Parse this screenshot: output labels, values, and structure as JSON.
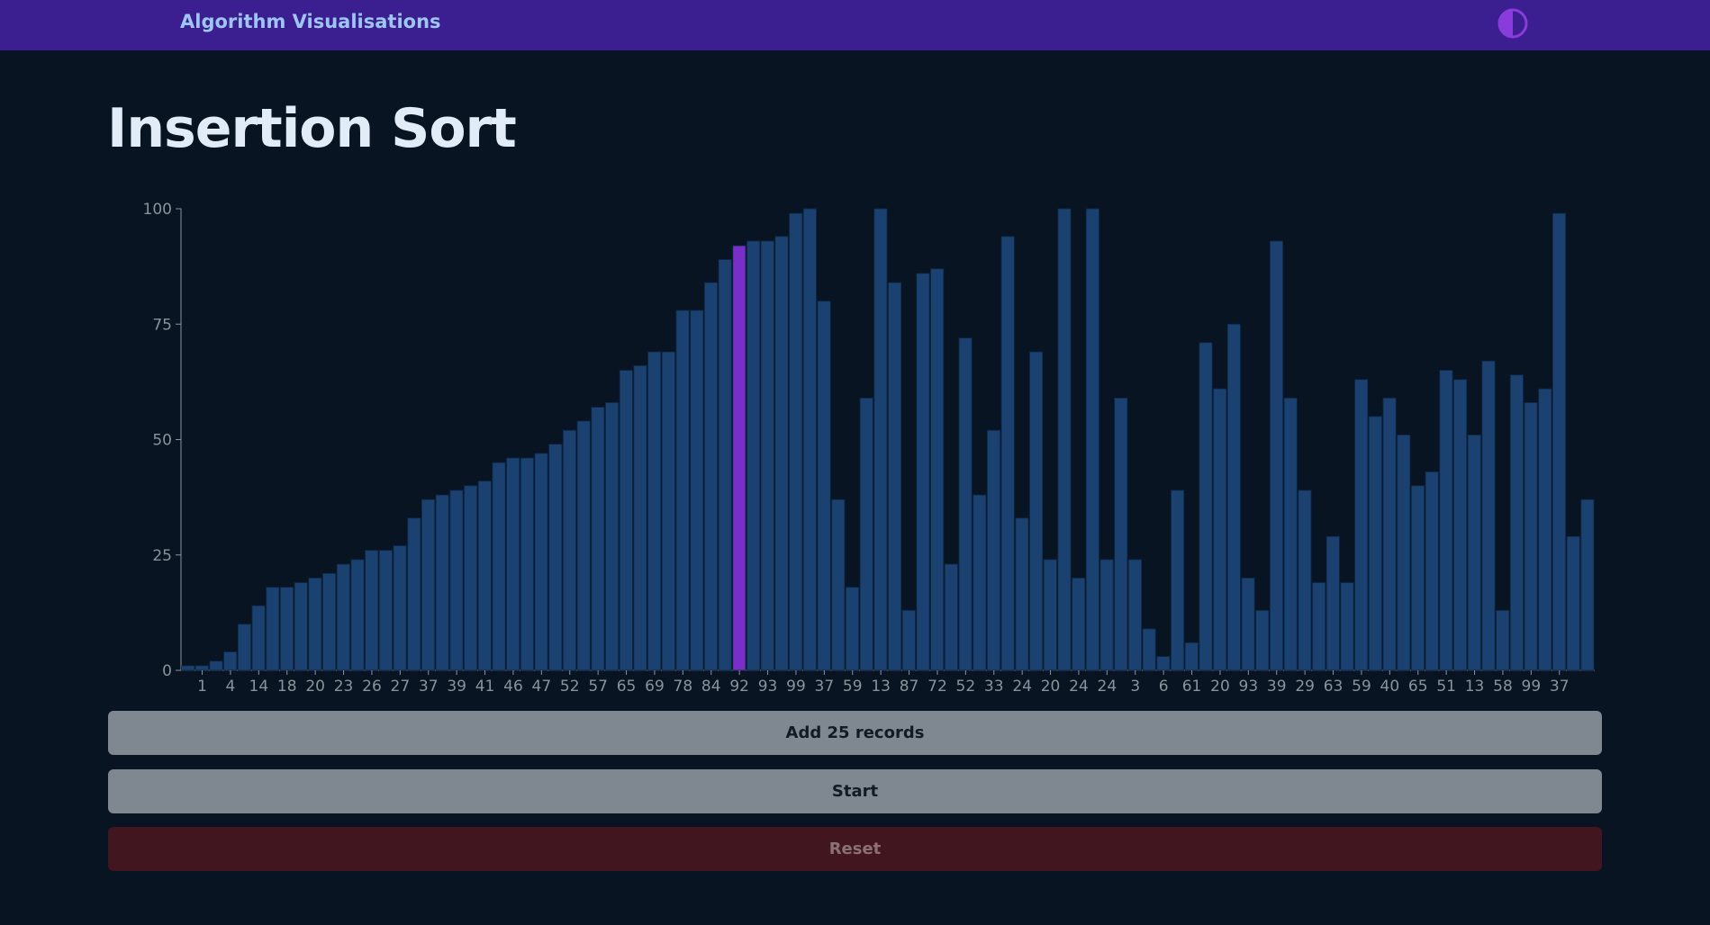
{
  "header": {
    "brand": "Algorithm Visualisations",
    "theme_toggle_icon": "contrast-icon"
  },
  "page": {
    "title": "Insertion Sort"
  },
  "controls": {
    "add_label": "Add 25 records",
    "start_label": "Start",
    "reset_label": "Reset"
  },
  "colors": {
    "bar": "#1a4170",
    "highlight": "#7a2ec8",
    "axis": "#8a939d",
    "topbar": "#3b1e90"
  },
  "chart_data": {
    "type": "bar",
    "title": "",
    "xlabel": "",
    "ylabel": "",
    "ylim": [
      0,
      100
    ],
    "yticks": [
      0,
      25,
      50,
      75,
      100
    ],
    "grid": false,
    "highlight_index": 39,
    "values": [
      1,
      1,
      2,
      4,
      10,
      14,
      18,
      18,
      19,
      20,
      21,
      23,
      24,
      26,
      26,
      27,
      33,
      37,
      38,
      39,
      40,
      41,
      45,
      46,
      46,
      47,
      49,
      52,
      54,
      57,
      58,
      65,
      66,
      69,
      69,
      78,
      78,
      84,
      89,
      92,
      93,
      93,
      94,
      99,
      100,
      80,
      37,
      18,
      59,
      100,
      84,
      13,
      86,
      87,
      23,
      72,
      38,
      52,
      94,
      33,
      69,
      24,
      100,
      20,
      100,
      24,
      59,
      24,
      9,
      3,
      39,
      6,
      71,
      61,
      75,
      20,
      13,
      93,
      59,
      39,
      19,
      29,
      19,
      63,
      55,
      59,
      51,
      40,
      43,
      65,
      63,
      51,
      67,
      13,
      64,
      58,
      61,
      99,
      29,
      37
    ],
    "tick_labels": [
      "1",
      "4",
      "14",
      "18",
      "20",
      "23",
      "26",
      "27",
      "37",
      "39",
      "41",
      "46",
      "47",
      "52",
      "57",
      "65",
      "69",
      "78",
      "84",
      "92",
      "93",
      "99",
      "37",
      "59",
      "13",
      "87",
      "72",
      "52",
      "33",
      "24",
      "20",
      "24",
      "24",
      "3",
      "6",
      "61",
      "20",
      "93",
      "39",
      "29",
      "63",
      "59",
      "40",
      "65",
      "51",
      "13",
      "58",
      "99",
      "37"
    ]
  }
}
